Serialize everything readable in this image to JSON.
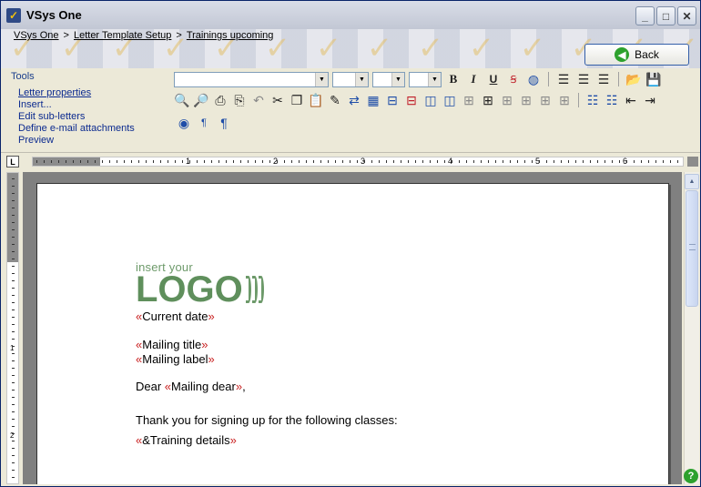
{
  "window": {
    "title": "VSys One",
    "app_icon": "vsys-logo-icon"
  },
  "breadcrumb": {
    "items": [
      "VSys One",
      "Letter Template Setup",
      "Trainings upcoming"
    ],
    "separator": ">"
  },
  "back_button": {
    "label": "Back",
    "icon": "back-arrow-icon"
  },
  "tools": {
    "title": "Tools",
    "links": [
      "Letter properties",
      "Insert...",
      "Edit sub-letters",
      "Define e-mail attachments",
      "Preview"
    ]
  },
  "toolbar": {
    "bold": "B",
    "italic": "I",
    "underline": "U",
    "pilcrow": "¶"
  },
  "ruler": {
    "corner": "L",
    "numbers": [
      "1",
      "2",
      "3",
      "4",
      "5",
      "6"
    ],
    "vertical_numbers": [
      "1",
      "2"
    ]
  },
  "document": {
    "logo_small": "insert your",
    "logo_big": "LOGO",
    "chev_open": "«",
    "chev_close": "»",
    "current_date": "Current date",
    "mailing_title": "Mailing title",
    "mailing_label": "Mailing label",
    "dear_prefix": "Dear ",
    "mailing_dear": "Mailing dear",
    "dear_suffix": ",",
    "body_text": "Thank you for signing up for the following classes:",
    "training_details": "&Training details"
  },
  "help": {
    "label": "?"
  },
  "colors": {
    "field_marker": "#c81e1e",
    "link": "#0b2a8f",
    "logo_green": "#5f8f5c"
  }
}
